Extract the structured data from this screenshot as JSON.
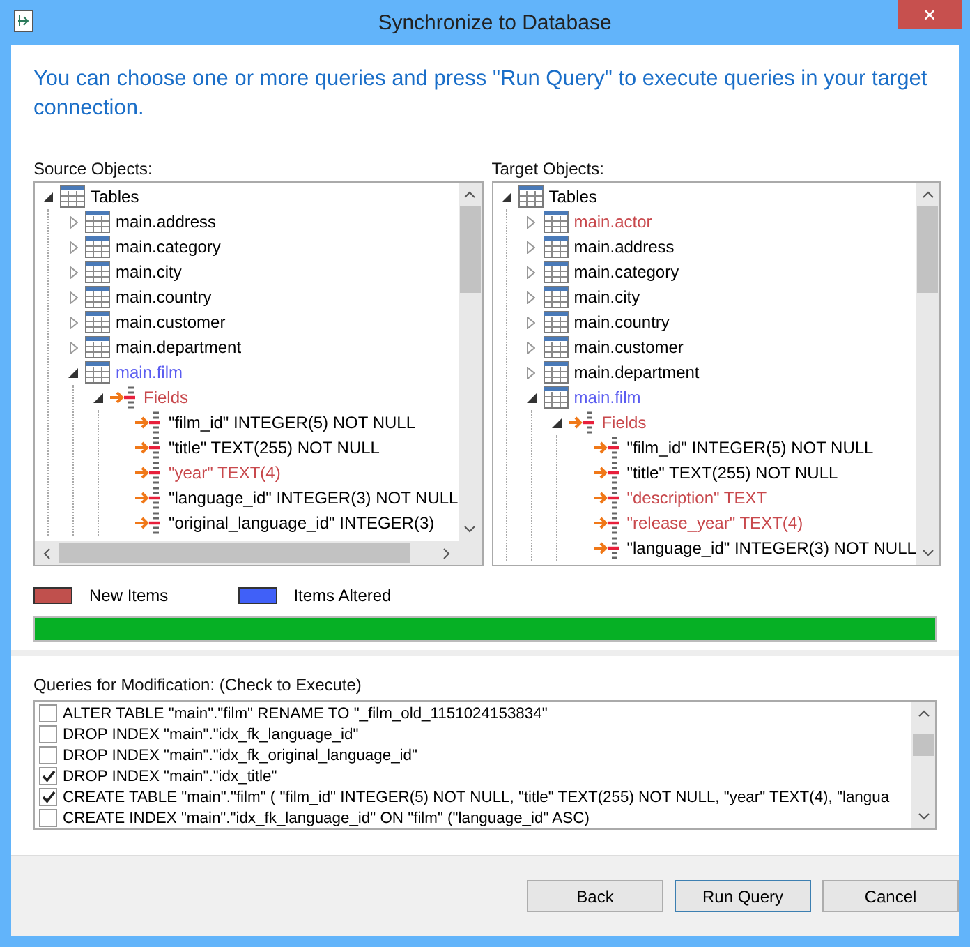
{
  "window": {
    "title": "Synchronize to Database",
    "close": "✕"
  },
  "intro": "You can choose one or more queries and press \"Run Query\" to execute queries in your target connection.",
  "source": {
    "label": "Source Objects:",
    "tree": [
      {
        "label": "Tables",
        "kind": "folder",
        "added": false,
        "altered": false,
        "expanded": true,
        "children": [
          {
            "label": "main.address",
            "kind": "table",
            "added": false,
            "altered": false,
            "expanded": false
          },
          {
            "label": "main.category",
            "kind": "table",
            "added": false,
            "altered": false,
            "expanded": false
          },
          {
            "label": "main.city",
            "kind": "table",
            "added": false,
            "altered": false,
            "expanded": false
          },
          {
            "label": "main.country",
            "kind": "table",
            "added": false,
            "altered": false,
            "expanded": false
          },
          {
            "label": "main.customer",
            "kind": "table",
            "added": false,
            "altered": false,
            "expanded": false
          },
          {
            "label": "main.department",
            "kind": "table",
            "added": false,
            "altered": false,
            "expanded": false
          },
          {
            "label": "main.film",
            "kind": "table",
            "added": false,
            "altered": true,
            "expanded": true,
            "children": [
              {
                "label": "Fields",
                "kind": "fields",
                "added": true,
                "altered": false,
                "expanded": true,
                "children": [
                  {
                    "label": "\"film_id\" INTEGER(5) NOT NULL",
                    "kind": "field",
                    "added": false,
                    "altered": false
                  },
                  {
                    "label": "\"title\" TEXT(255) NOT NULL",
                    "kind": "field",
                    "added": false,
                    "altered": false
                  },
                  {
                    "label": "\"year\" TEXT(4)",
                    "kind": "field",
                    "added": true,
                    "altered": false
                  },
                  {
                    "label": "\"language_id\" INTEGER(3) NOT NULL",
                    "kind": "field",
                    "added": false,
                    "altered": false
                  },
                  {
                    "label": "\"original_language_id\" INTEGER(3)",
                    "kind": "field",
                    "added": false,
                    "altered": false
                  }
                ]
              }
            ]
          }
        ]
      }
    ]
  },
  "target": {
    "label": "Target Objects:",
    "tree": [
      {
        "label": "Tables",
        "kind": "folder",
        "added": false,
        "altered": false,
        "expanded": true,
        "children": [
          {
            "label": "main.actor",
            "kind": "table",
            "added": true,
            "altered": false,
            "expanded": false
          },
          {
            "label": "main.address",
            "kind": "table",
            "added": false,
            "altered": false,
            "expanded": false
          },
          {
            "label": "main.category",
            "kind": "table",
            "added": false,
            "altered": false,
            "expanded": false
          },
          {
            "label": "main.city",
            "kind": "table",
            "added": false,
            "altered": false,
            "expanded": false
          },
          {
            "label": "main.country",
            "kind": "table",
            "added": false,
            "altered": false,
            "expanded": false
          },
          {
            "label": "main.customer",
            "kind": "table",
            "added": false,
            "altered": false,
            "expanded": false
          },
          {
            "label": "main.department",
            "kind": "table",
            "added": false,
            "altered": false,
            "expanded": false
          },
          {
            "label": "main.film",
            "kind": "table",
            "added": false,
            "altered": true,
            "expanded": true,
            "children": [
              {
                "label": "Fields",
                "kind": "fields",
                "added": true,
                "altered": false,
                "expanded": true,
                "children": [
                  {
                    "label": "\"film_id\" INTEGER(5) NOT NULL",
                    "kind": "field",
                    "added": false,
                    "altered": false
                  },
                  {
                    "label": "\"title\" TEXT(255) NOT NULL",
                    "kind": "field",
                    "added": false,
                    "altered": false
                  },
                  {
                    "label": "\"description\" TEXT",
                    "kind": "field",
                    "added": true,
                    "altered": false
                  },
                  {
                    "label": "\"release_year\" TEXT(4)",
                    "kind": "field",
                    "added": true,
                    "altered": false
                  },
                  {
                    "label": "\"language_id\" INTEGER(3) NOT NULL",
                    "kind": "field",
                    "added": false,
                    "altered": false
                  }
                ]
              }
            ]
          }
        ]
      }
    ]
  },
  "legend": [
    {
      "label": "New Items",
      "color": "#c0504d"
    },
    {
      "label": "Items Altered",
      "color": "#4060f8"
    }
  ],
  "progress": {
    "level": 1
  },
  "queries": {
    "label": "Queries for Modification: (Check to Execute)",
    "items": [
      {
        "text": "ALTER TABLE \"main\".\"film\" RENAME TO \"_film_old_1151024153834\"",
        "checked": false
      },
      {
        "text": "DROP INDEX \"main\".\"idx_fk_language_id\"",
        "checked": false
      },
      {
        "text": "DROP INDEX \"main\".\"idx_fk_original_language_id\"",
        "checked": false
      },
      {
        "text": "DROP INDEX \"main\".\"idx_title\"",
        "checked": true
      },
      {
        "text": "CREATE TABLE \"main\".\"film\" ( \"film_id\" INTEGER(5) NOT NULL, \"title\" TEXT(255) NOT NULL, \"year\" TEXT(4), \"langua",
        "checked": true
      },
      {
        "text": "CREATE INDEX \"main\".\"idx_fk_language_id\" ON \"film\" (\"language_id\" ASC)",
        "checked": false
      }
    ]
  },
  "buttons": [
    "Back",
    "Run Query",
    "Cancel"
  ]
}
